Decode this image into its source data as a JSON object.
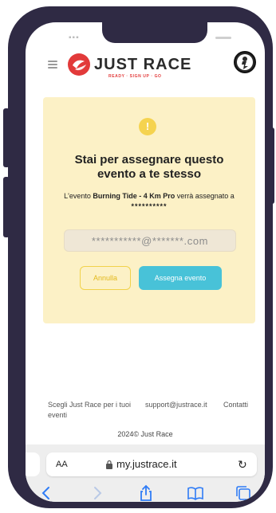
{
  "header": {
    "logo_text": "JUST RACE",
    "logo_tagline": "READY · SIGN UP · GO",
    "menu_icon": "hamburger-menu-icon",
    "profile_icon": "profile-icon"
  },
  "dialog": {
    "icon": "warning-icon",
    "icon_glyph": "!",
    "title": "Stai per assegnare questo evento a te stesso",
    "desc_prefix": "L'evento ",
    "event_name": "Burning Tide - 4 Km Pro",
    "desc_middle": " verrà assegnato a",
    "masked_user": "**********",
    "email_value": "***********@*******.com",
    "cancel_label": "Annulla",
    "assign_label": "Assegna evento"
  },
  "footer": {
    "link_1": "Scegli Just Race per i tuoi eventi",
    "link_2": "support@justrace.it",
    "link_3": "Contatti",
    "copyright": "2024© Just Race"
  },
  "browser": {
    "text_size_label": "AA",
    "url": "my.justrace.it",
    "reload_glyph": "↻"
  },
  "colors": {
    "frame": "#2f2a44",
    "card_bg": "#fcf1c6",
    "warning": "#f5d34f",
    "accent_cyan": "#48c2d8",
    "accent_red": "#e23a3a",
    "nav_blue": "#2f7cf6"
  }
}
